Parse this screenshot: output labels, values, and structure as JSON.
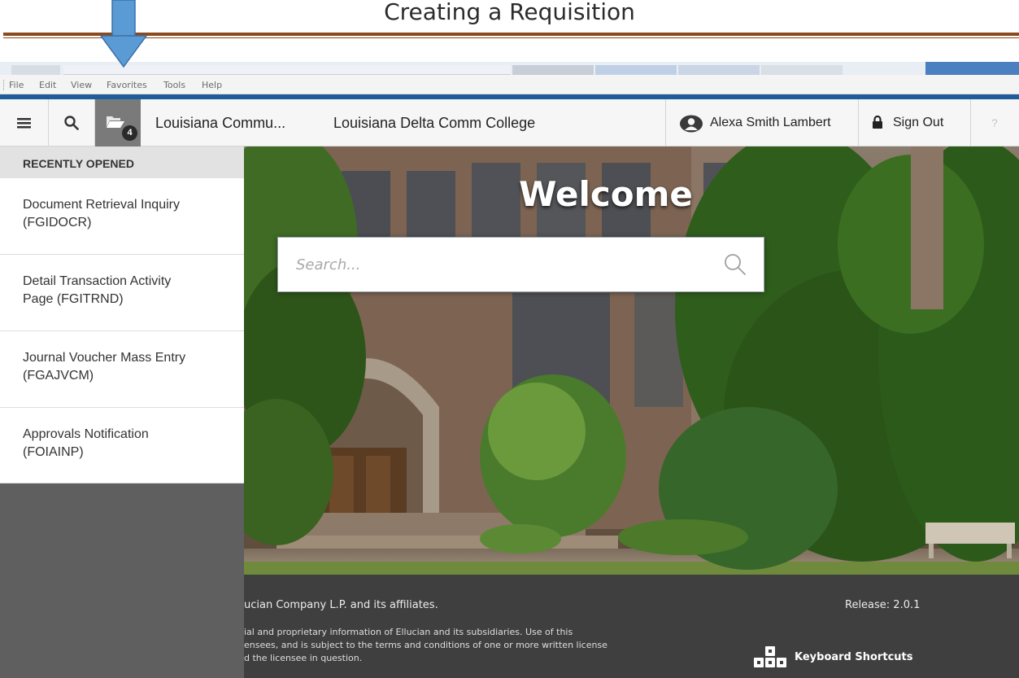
{
  "document": {
    "heading": "Creating a Requisition"
  },
  "browser": {
    "menus": [
      "File",
      "Edit",
      "View",
      "Favorites",
      "Tools",
      "Help"
    ]
  },
  "header": {
    "institution_short": "Louisiana Commu...",
    "institution_full": "Louisiana Delta Comm College",
    "user_name": "Alexa Smith Lambert",
    "sign_out_label": "Sign Out",
    "help_label": "?",
    "recent_count": "4"
  },
  "recent": {
    "title": "RECENTLY OPENED",
    "items": [
      {
        "line1": "Document Retrieval Inquiry",
        "line2": "(FGIDOCR)"
      },
      {
        "line1": "Detail Transaction Activity",
        "line2": "Page (FGITRND)"
      },
      {
        "line1": "Journal Voucher Mass Entry",
        "line2": "(FGAJVCM)"
      },
      {
        "line1": "Approvals Notification",
        "line2": "(FOIAINP)"
      }
    ]
  },
  "hero": {
    "welcome": "Welcome",
    "search_placeholder": "Search..."
  },
  "footer": {
    "copyright": "ucian Company L.P. and its affiliates.",
    "release": "Release: 2.0.1",
    "legal_line1": "ial and proprietary information of Ellucian and its subsidiaries. Use of this",
    "legal_line2": "ensees, and is subject to the terms and conditions of one or more written license",
    "legal_line3": "d the licensee in question.",
    "keyboard_shortcuts": "Keyboard Shortcuts"
  },
  "colors": {
    "accent_bar": "#1f5c99",
    "doc_rule": "#8a4a1e",
    "pointer_arrow": "#5b9bd5",
    "active_header_button": "#7a7a7a"
  },
  "icons": [
    "hamburger-menu-icon",
    "search-icon",
    "folder-icon",
    "user-avatar-icon",
    "lock-icon",
    "keyboard-icon",
    "down-arrow-pointer-icon"
  ]
}
